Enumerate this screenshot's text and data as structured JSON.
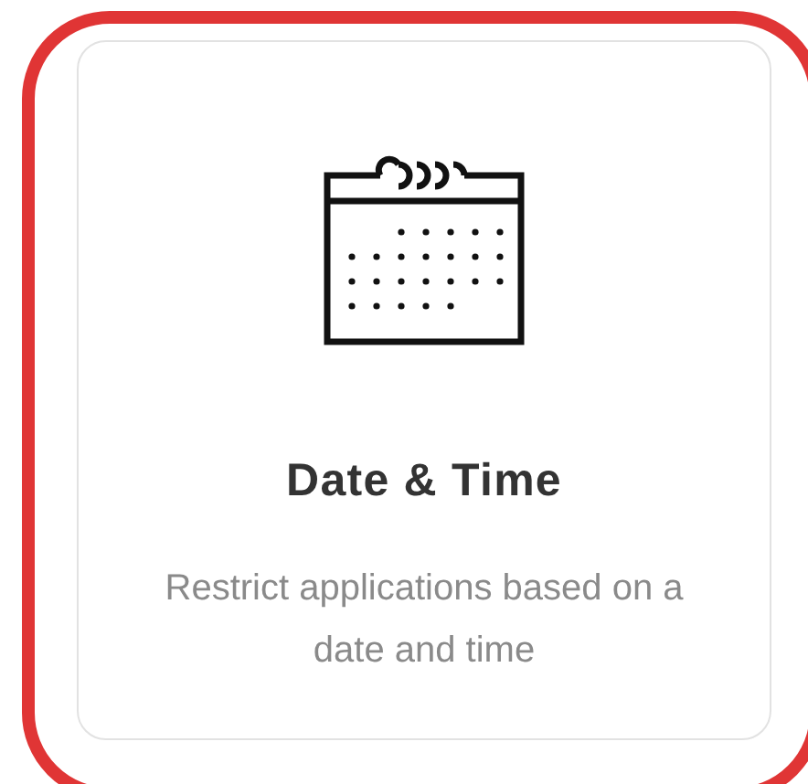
{
  "card": {
    "selected": true,
    "title": "Date & Time",
    "description": "Restrict applications based on a date and time"
  }
}
